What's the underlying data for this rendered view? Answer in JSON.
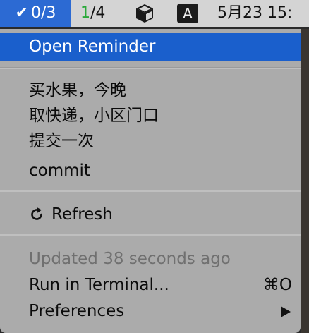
{
  "menubar": {
    "status_check": "✔",
    "status_count": "0/3",
    "counter_done": "1",
    "counter_total": "/4",
    "box_icon": "package-icon",
    "input_source": "A",
    "clock": "5月23 15:"
  },
  "menu": {
    "open_reminder": "Open Reminder",
    "reminders": [
      "买水果，今晚",
      "取快递，小区门口",
      "提交一次",
      "commit"
    ],
    "refresh_icon": "refresh-icon",
    "refresh": "Refresh",
    "updated": "Updated 38 seconds ago",
    "run_in_terminal": "Run in Terminal...",
    "run_shortcut": "⌘O",
    "preferences": "Preferences",
    "preferences_arrow": "submenu-arrow-icon"
  },
  "colors": {
    "highlight": "#1a5fcc",
    "menu_bg": "#ababab",
    "counter_done": "#2aa93a",
    "menubar_bg": "#d4d4d4"
  }
}
